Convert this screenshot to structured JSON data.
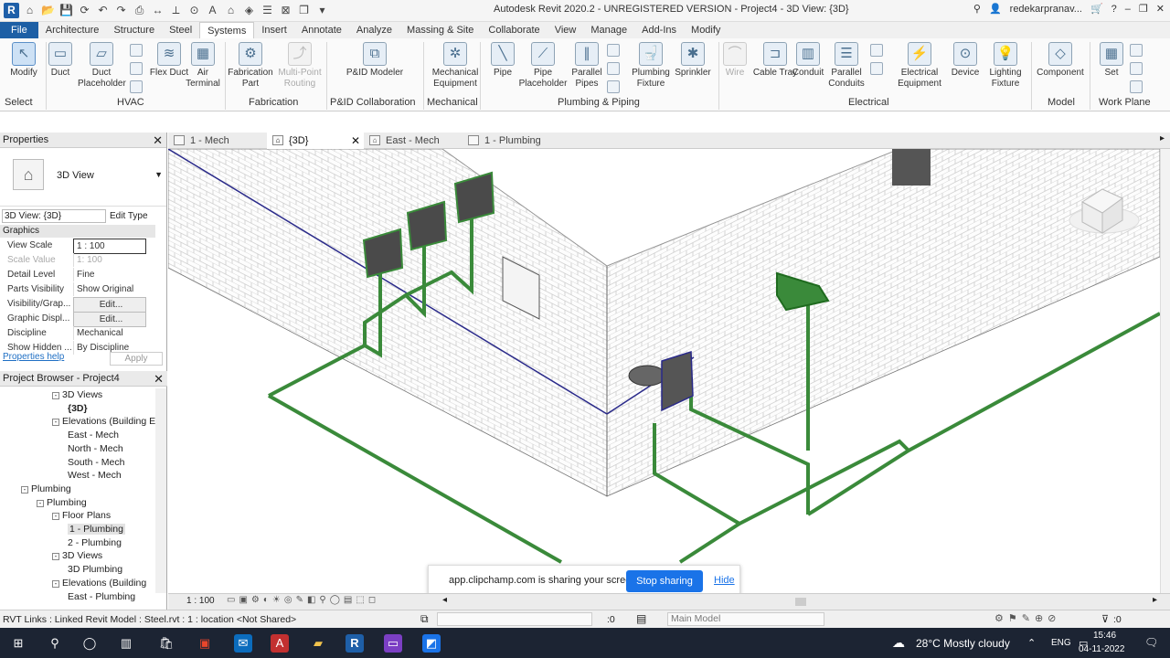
{
  "app": {
    "title": "Autodesk Revit 2020.2 - UNREGISTERED VERSION - Project4 - 3D View: {3D}",
    "user": "redekarpranav...",
    "help": "?"
  },
  "menu": {
    "tabs": [
      "File",
      "Architecture",
      "Structure",
      "Steel",
      "Systems",
      "Insert",
      "Annotate",
      "Analyze",
      "Massing & Site",
      "Collaborate",
      "View",
      "Manage",
      "Add-Ins",
      "Modify"
    ],
    "active": "Systems"
  },
  "ribbon": {
    "modify": "Modify",
    "duct": "Duct",
    "duct_placeholder": "Duct Placeholder",
    "flex_duct": "Flex Duct",
    "air_terminal": "Air Terminal",
    "fabrication_part": "Fabrication Part",
    "multi_point": "Multi-Point Routing",
    "pid_modeler": "P&ID Modeler",
    "mech_equipment": "Mechanical Equipment",
    "pipe": "Pipe",
    "pipe_placeholder": "Pipe Placeholder",
    "parallel_pipes": "Parallel Pipes",
    "plumbing_fixture": "Plumbing Fixture",
    "sprinkler": "Sprinkler",
    "wire": "Wire",
    "cable_tray": "Cable Tray",
    "conduit": "Conduit",
    "parallel_conduits": "Parallel Conduits",
    "elec_equipment": "Electrical Equipment",
    "device": "Device",
    "lighting_fixture": "Lighting Fixture",
    "component": "Component",
    "set": "Set",
    "groups": {
      "select": "Select",
      "hvac": "HVAC",
      "fabrication": "Fabrication",
      "pid": "P&ID Collaboration",
      "mechanical": "Mechanical",
      "plumbing": "Plumbing & Piping",
      "electrical": "Electrical",
      "model": "Model",
      "work_plane": "Work Plane"
    }
  },
  "doc_tabs": [
    "1 - Mech",
    "{3D}",
    "East - Mech",
    "1 - Plumbing"
  ],
  "properties": {
    "header": "Properties",
    "type_name": "3D View",
    "instance": "3D View: {3D}",
    "edit_type": "Edit Type",
    "section": "Graphics",
    "rows": [
      {
        "k": "View Scale",
        "v": "1 : 100"
      },
      {
        "k": "Scale Value",
        "v": "1: 100"
      },
      {
        "k": "Detail Level",
        "v": "Fine"
      },
      {
        "k": "Parts Visibility",
        "v": "Show Original"
      },
      {
        "k": "Visibility/Grap...",
        "v": "Edit..."
      },
      {
        "k": "Graphic Displ...",
        "v": "Edit..."
      },
      {
        "k": "Discipline",
        "v": "Mechanical"
      },
      {
        "k": "Show Hidden ...",
        "v": "By Discipline"
      }
    ],
    "help": "Properties help",
    "apply": "Apply"
  },
  "browser": {
    "header": "Project Browser - Project4",
    "items": [
      {
        "t": "3D Views",
        "lvl": 3,
        "sq": "-"
      },
      {
        "t": "{3D}",
        "lvl": 4,
        "bold": true
      },
      {
        "t": "Elevations (Building E",
        "lvl": 3,
        "sq": "-"
      },
      {
        "t": "East - Mech",
        "lvl": 4
      },
      {
        "t": "North - Mech",
        "lvl": 4
      },
      {
        "t": "South - Mech",
        "lvl": 4
      },
      {
        "t": "West - Mech",
        "lvl": 4
      },
      {
        "t": "Plumbing",
        "lvl": 1,
        "sq": "-"
      },
      {
        "t": "Plumbing",
        "lvl": 2,
        "sq": "-"
      },
      {
        "t": "Floor Plans",
        "lvl": 3,
        "sq": "-"
      },
      {
        "t": "1 - Plumbing",
        "lvl": 4,
        "hl": true
      },
      {
        "t": "2 - Plumbing",
        "lvl": 4
      },
      {
        "t": "3D Views",
        "lvl": 3,
        "sq": "-"
      },
      {
        "t": "3D Plumbing",
        "lvl": 4
      },
      {
        "t": "Elevations (Building",
        "lvl": 3,
        "sq": "-"
      },
      {
        "t": "East - Plumbing",
        "lvl": 4
      }
    ]
  },
  "viewbar": {
    "scale": "1 : 100"
  },
  "status": {
    "text": "RVT Links : Linked Revit Model : Steel.rvt : 1 : location <Not Shared>",
    "zero": ":0",
    "model": "Main Model",
    "filter": ":0"
  },
  "share": {
    "text": "app.clipchamp.com is sharing your screen.",
    "stop": "Stop sharing",
    "hide": "Hide"
  },
  "taskbar": {
    "weather": "28°C  Mostly cloudy",
    "lang": "ENG",
    "time": "15:46",
    "date": "04-11-2022"
  },
  "colors": {
    "pipe": "#3a8a3a",
    "pipe_dark": "#1f6b1f",
    "duct_line": "#2a2a8a",
    "file_tab": "#1d5fa5"
  }
}
